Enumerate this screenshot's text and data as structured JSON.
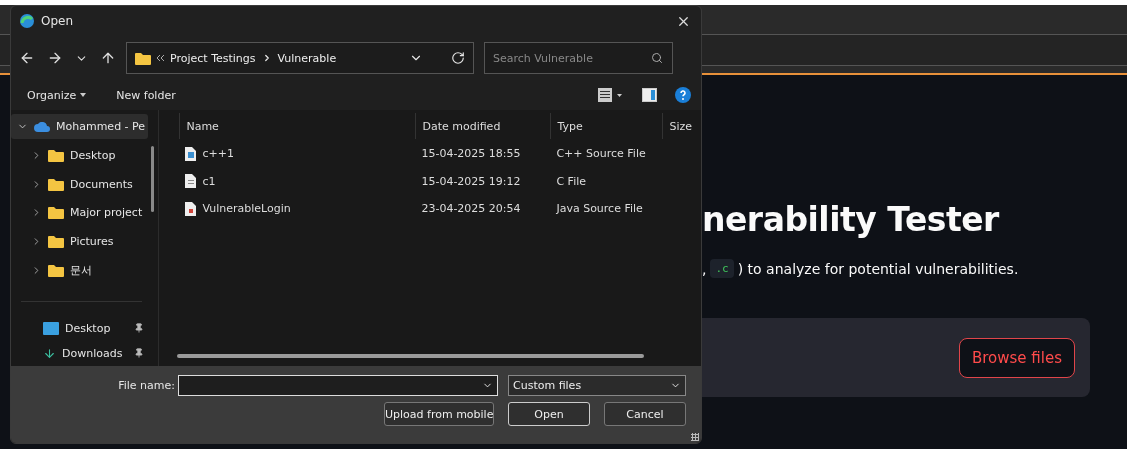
{
  "window": {
    "title": "Open"
  },
  "address": {
    "crumbs": [
      "Project Testings",
      "Vulnerable"
    ]
  },
  "search": {
    "placeholder": "Search Vulnerable"
  },
  "commands": {
    "organize": "Organize",
    "new_folder": "New folder"
  },
  "sidebar": {
    "tree": [
      {
        "label": "Mohammed - Pe",
        "expanded": true,
        "selected": true,
        "children": [
          {
            "label": "Desktop",
            "expanded": false,
            "selected": false
          },
          {
            "label": "Documents",
            "expanded": false,
            "selected": false
          },
          {
            "label": "Major project",
            "expanded": false,
            "selected": false
          },
          {
            "label": "Pictures",
            "expanded": false,
            "selected": false
          },
          {
            "label": "문서",
            "expanded": false,
            "selected": false
          }
        ]
      }
    ],
    "quick_access": [
      {
        "label": "Desktop",
        "kind": "desktop",
        "pinned": true
      },
      {
        "label": "Downloads",
        "kind": "downloads",
        "pinned": true
      }
    ]
  },
  "table": {
    "columns": [
      "Name",
      "Date modified",
      "Type",
      "Size"
    ],
    "rows": [
      {
        "name": "c++1",
        "date": "15-04-2025 18:55",
        "type": "C++ Source File",
        "kind": "cpp"
      },
      {
        "name": "c1",
        "date": "15-04-2025 19:12",
        "type": "C File",
        "kind": "c"
      },
      {
        "name": "VulnerableLogin",
        "date": "23-04-2025 20:54",
        "type": "Java Source File",
        "kind": "java"
      }
    ]
  },
  "footer": {
    "file_name_label": "File name:",
    "filter": "Custom files",
    "buttons": [
      "Upload from mobile",
      "Open",
      "Cancel"
    ]
  },
  "page": {
    "title": "nerability Tester",
    "subtitle_lead": ",",
    "code": ".c",
    "subtitle": ") to analyze for potential vulnerabilities.",
    "browse": "Browse files"
  }
}
